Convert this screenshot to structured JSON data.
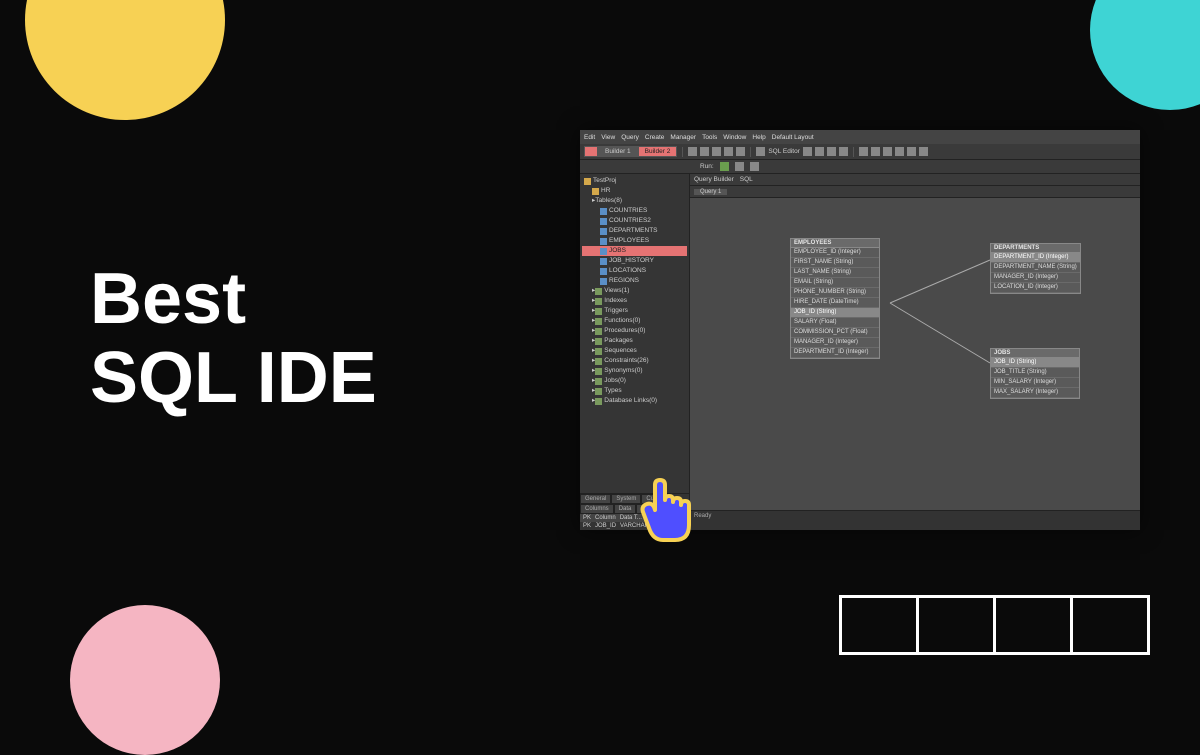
{
  "headline_line1": "Best",
  "headline_line2": "SQL IDE",
  "ide": {
    "menubar": [
      "Edit",
      "View",
      "Query",
      "Create",
      "Manager",
      "Tools",
      "Window",
      "Help",
      "Default Layout"
    ],
    "tabs": [
      {
        "label": "",
        "active": true
      },
      {
        "label": "Builder 1",
        "active": false
      },
      {
        "label": "Builder 2",
        "active": true
      }
    ],
    "toolbar_text": "SQL Editor",
    "runbar": {
      "run": "Run:",
      "querybuilder": "Query Builder",
      "sql": "SQL"
    },
    "query_tab": "Query 1",
    "tree_root": "TestProj",
    "tree_schema": "HR",
    "tree_tables_group": "Tables(8)",
    "tables": [
      "COUNTRIES",
      "COUNTRIES2",
      "DEPARTMENTS",
      "EMPLOYEES",
      "JOBS",
      "JOB_HISTORY",
      "LOCATIONS",
      "REGIONS"
    ],
    "selected_table_index": 4,
    "tree_groups": [
      "Views(1)",
      "Indexes",
      "Triggers",
      "Functions(0)",
      "Procedures(0)",
      "Packages",
      "Sequences",
      "Constraints(26)",
      "Synonyms(0)",
      "Jobs(0)",
      "Types",
      "Database Links(0)"
    ],
    "sidebar_tabs": [
      "General",
      "System",
      "Current"
    ],
    "sidebar_tabs2": [
      "Columns",
      "Data",
      "Keys"
    ],
    "col_header": {
      "pk": "PK",
      "col": "Column",
      "type": "Data T..."
    },
    "col_row": {
      "pk": "PK",
      "col": "JOB_ID",
      "type": "VARCHAR(2)"
    },
    "status_text": "Ready",
    "entities": {
      "employees": {
        "title": "EMPLOYEES",
        "cols": [
          "EMPLOYEE_ID (Integer)",
          "FIRST_NAME (String)",
          "LAST_NAME (String)",
          "EMAIL (String)",
          "PHONE_NUMBER (String)",
          "HIRE_DATE (DateTime)",
          "JOB_ID (String)",
          "SALARY (Float)",
          "COMMISSION_PCT (Float)",
          "MANAGER_ID (Integer)",
          "DEPARTMENT_ID (Integer)"
        ],
        "sel": 6
      },
      "departments": {
        "title": "DEPARTMENTS",
        "cols": [
          "DEPARTMENT_ID (Integer)",
          "DEPARTMENT_NAME (String)",
          "MANAGER_ID (Integer)",
          "LOCATION_ID (Integer)"
        ],
        "sel": 0
      },
      "jobs": {
        "title": "JOBS",
        "cols": [
          "JOB_ID (String)",
          "JOB_TITLE (String)",
          "MIN_SALARY (Integer)",
          "MAX_SALARY (Integer)"
        ],
        "sel": 0
      }
    }
  }
}
